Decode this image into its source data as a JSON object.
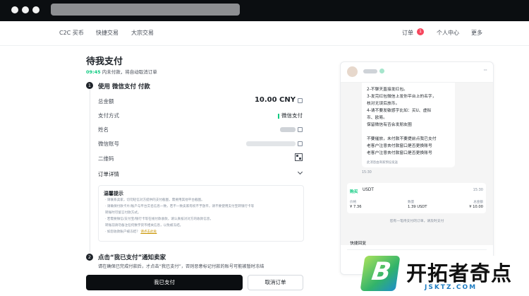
{
  "nav": {
    "c2c": "C2C 买币",
    "quick": "快捷交易",
    "bulk": "大宗交易",
    "orders": "订单",
    "orders_badge": "1",
    "profile": "个人中心",
    "more": "更多"
  },
  "order": {
    "title": "待我支付",
    "countdown_time": "09:45",
    "countdown_text": " 内未付款，将自动取消订单",
    "step1_num": "1",
    "step1_title": "使用 微信支付 付款",
    "rows": {
      "total_label": "总金额",
      "total_value": "10.00 CNY",
      "method_label": "支付方式",
      "method_value": "微信支付",
      "name_label": "姓名",
      "account_label": "微信账号",
      "qr_label": "二维码",
      "details_label": "订单详情"
    },
    "tips": {
      "title": "温馨提示",
      "lines": [
        "· 请联系卖家，切勿轻信对方提供的支付截图，需要用其他平台截图。",
        "· 请确保付款卡片/账户与平台实名信息一致，若不一致卖家有权不予放币，请不要使用支付宝转银行卡等",
        "  转账时可留言付款方式。",
        "· 若需要微信/支付宝/银行卡等在线付款收款，请认真核对对方的收款信息，",
        "  转账前请勿备注任何数字货币相关信息，以免被冻结。",
        "· 如您收款账户被冻结？"
      ],
      "link": "请点击此处"
    },
    "step2_num": "2",
    "step2_title": "点击“我已支付”通知卖家",
    "step2_desc": "请在确保已完成付款后，才点击“我已支付”，否则恶意标记付款的账号可能被暂时冻结",
    "paid_button": "我已支付",
    "cancel_button": "取消订单"
  },
  "chat": {
    "menu": "···",
    "message_lines": [
      "2-不聊天直接发红包。",
      "3-发完红包微信上发你平台上的名字，",
      "核对无误后放币。",
      "4-请不要发敏感字比如：买U、虚拟",
      "币、欧易。",
      "保留微信有否会发朋友圈",
      "",
      "不要催放，未付款不要提前点我已支付",
      "老客户注意去付款窗口是否更换账号",
      "老客户注意去付款窗口是否更换账号"
    ],
    "message_note": "此消息由商家预设发送",
    "message_time": "15:30",
    "order_card": {
      "type": "购买",
      "asset": "USDT",
      "time": "15:30",
      "price_label": "价格",
      "price_value": "¥ 7.36",
      "qty_label": "数量",
      "qty_value": "1.39 USDT",
      "total_label": "总金额",
      "total_value": "¥ 10.00"
    },
    "system_msg": "您有一笔待支付的订单，请及时支付",
    "quick_reply": "快捷回复"
  },
  "watermark": {
    "name": "开拓者奇点",
    "url": "JSKTZ.COM",
    "letter": "B"
  }
}
